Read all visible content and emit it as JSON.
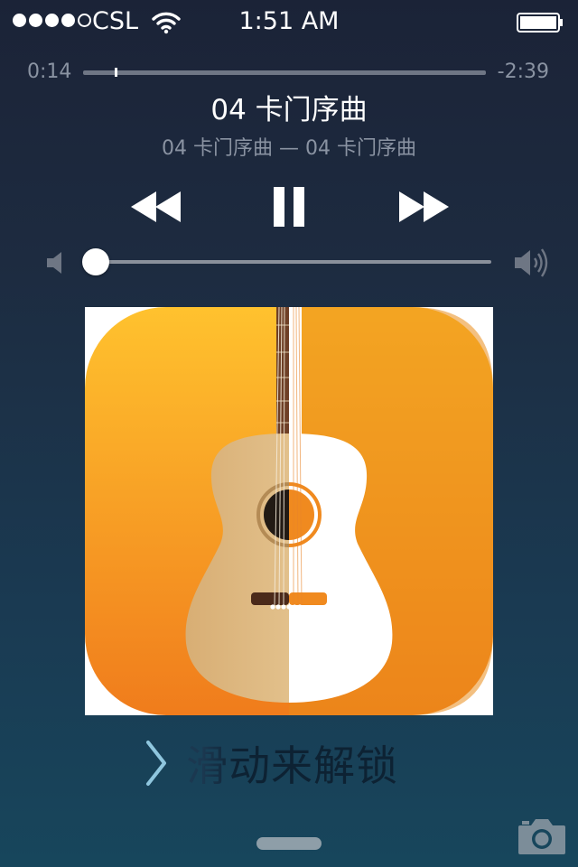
{
  "status_bar": {
    "carrier": "CSL",
    "time": "1:51 AM",
    "signal_bars_filled": 4,
    "signal_bars_total": 5,
    "icons": [
      "wifi-icon",
      "battery-icon"
    ]
  },
  "now_playing": {
    "elapsed": "0:14",
    "remaining": "-2:39",
    "title": "04 卡门序曲",
    "subtitle": "04 卡门序曲 — 04 卡门序曲",
    "progress_fraction": 0.08,
    "volume_fraction": 0.0
  },
  "controls": {
    "icons": [
      "rewind-icon",
      "pause-icon",
      "fast-forward-icon",
      "volume-low-icon",
      "volume-high-icon"
    ]
  },
  "artwork": {
    "description_icon": "guitar-artwork",
    "colors": {
      "orange_top": "#ffc22e",
      "orange_bottom": "#f07c1c"
    }
  },
  "lock_screen": {
    "slide_to_unlock": "滑动来解锁",
    "icons": [
      "chevron-right-icon",
      "camera-icon"
    ]
  },
  "colors": {
    "background_top": "#1b2337",
    "background_bottom": "#17465c",
    "secondary_text": "#8a93a2"
  }
}
